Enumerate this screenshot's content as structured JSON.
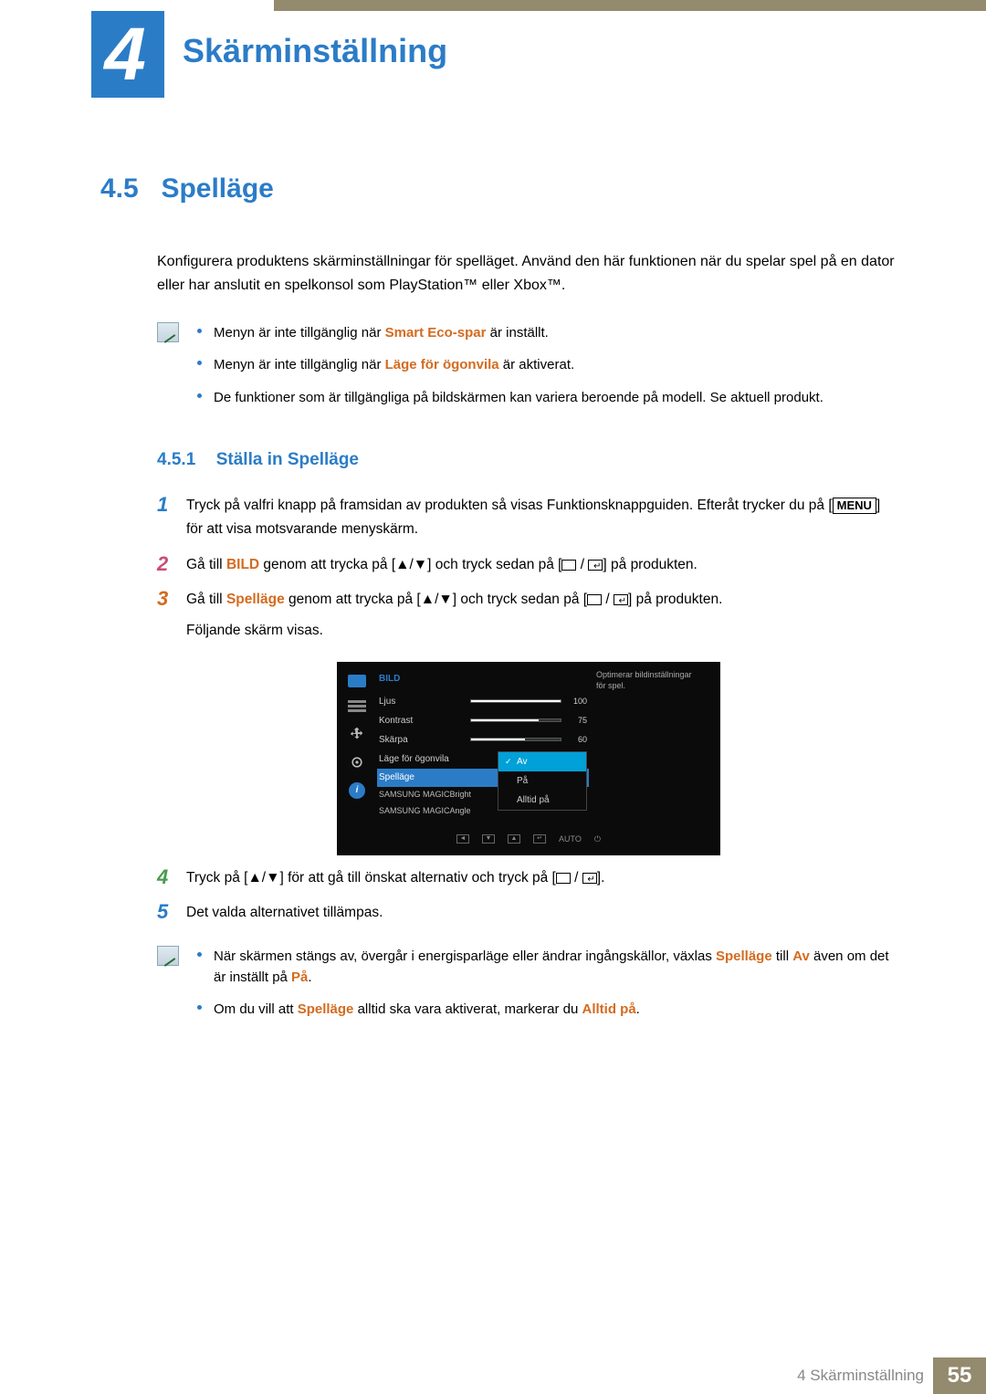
{
  "chapter": {
    "number": "4",
    "title": "Skärminställning"
  },
  "section": {
    "number": "4.5",
    "title": "Spelläge",
    "intro": "Konfigurera produktens skärminställningar för spelläget. Använd den här funktionen när du spelar spel på en dator eller har anslutit en spelkonsol som PlayStation™ eller Xbox™."
  },
  "notes1": {
    "items": [
      {
        "pre": "Menyn är inte tillgänglig när ",
        "hl": "Smart Eco-spar",
        "post": " är inställt."
      },
      {
        "pre": "Menyn är inte tillgänglig när ",
        "hl": "Läge för ögonvila",
        "post": " är aktiverat."
      },
      {
        "pre": "De funktioner som är tillgängliga på bildskärmen kan variera beroende på modell. Se aktuell produkt.",
        "hl": "",
        "post": ""
      }
    ]
  },
  "subsection": {
    "number": "4.5.1",
    "title": "Ställa in Spelläge"
  },
  "steps": {
    "s1": {
      "line1": "Tryck på valfri knapp på framsidan av produkten så visas Funktionsknappguiden. Efteråt trycker du på [",
      "menu": "MENU",
      "line1b": "] för att visa motsvarande menyskärm."
    },
    "s2": {
      "a": "Gå till ",
      "bild": "BILD",
      "b": " genom att trycka på [",
      "arrows": "▲/▼",
      "c": "] och tryck sedan på [",
      "d": "] på produkten."
    },
    "s3": {
      "a": "Gå till ",
      "spel": "Spelläge",
      "b": " genom att trycka på [",
      "arrows": "▲/▼",
      "c": "] och tryck sedan på [",
      "d": "] på produkten.",
      "follow": "Följande skärm visas."
    },
    "s4": {
      "a": "Tryck på [",
      "arrows": "▲/▼",
      "b": "] för att gå till önskat alternativ och tryck på [",
      "c": "]."
    },
    "s5": "Det valda alternativet tillämpas."
  },
  "notes2": {
    "n1": {
      "a": "När skärmen stängs av, övergår i energisparläge eller ändrar ingångskällor, växlas ",
      "spel": "Spelläge",
      "b": " till ",
      "av": "Av",
      "c": " även om det är inställt på ",
      "pa": "På",
      "d": "."
    },
    "n2": {
      "a": "Om du vill att ",
      "spel": "Spelläge",
      "b": " alltid ska vara aktiverat, markerar du ",
      "alltid": "Alltid på",
      "c": "."
    }
  },
  "osd": {
    "header": "BILD",
    "rows": [
      {
        "label": "Ljus",
        "value": 100,
        "pct": 100
      },
      {
        "label": "Kontrast",
        "value": 75,
        "pct": 75
      },
      {
        "label": "Skärpa",
        "value": 60,
        "pct": 60
      }
    ],
    "eyesaver": "Läge för ögonvila",
    "selected": "Spelläge",
    "magic1": "SAMSUNG MAGICBright",
    "magic2": "SAMSUNG MAGICAngle",
    "popup": [
      "Av",
      "På",
      "Alltid på"
    ],
    "description": "Optimerar bildinställningar för spel.",
    "footer_auto": "AUTO"
  },
  "footer": {
    "text": "4 Skärminställning",
    "page": "55"
  }
}
